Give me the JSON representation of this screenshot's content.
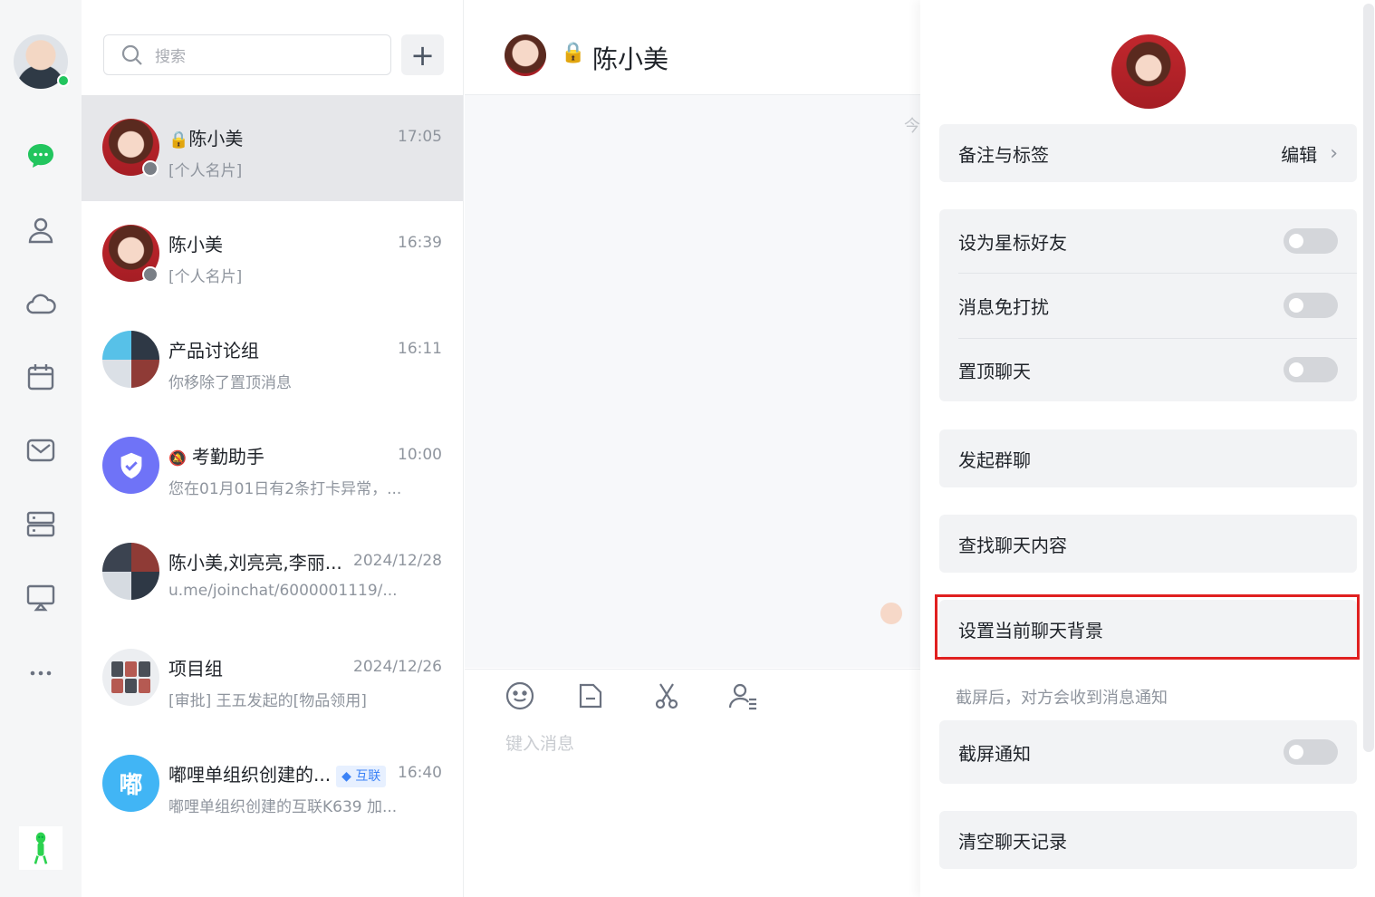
{
  "search": {
    "placeholder": "搜索"
  },
  "chats": [
    {
      "name": "陈小美",
      "time": "17:05",
      "preview": "[个人名片]",
      "locked": true
    },
    {
      "name": "陈小美",
      "time": "16:39",
      "preview": "[个人名片]"
    },
    {
      "name": "产品讨论组",
      "time": "16:11",
      "preview": "你移除了置顶消息"
    },
    {
      "name": "考勤助手",
      "time": "10:00",
      "preview": "您在01月01日有2条打卡异常，..."
    },
    {
      "name": "陈小美,刘亮亮,李丽...",
      "time": "2024/12/28",
      "preview": "u.me/joinchat/6000001119/..."
    },
    {
      "name": "项目组",
      "time": "2024/12/26",
      "preview": "[审批] 王五发起的[物品领用]"
    },
    {
      "name": "嘟哩单组织创建的...",
      "time": "16:40",
      "preview": "嘟哩单组织创建的互联K639 加...",
      "tag": "互联",
      "avatar_text": "嘟"
    }
  ],
  "chat": {
    "title": "陈小美",
    "today_marker": "今",
    "input_placeholder": "键入消息"
  },
  "settings": {
    "remark_label": "备注与标签",
    "edit_label": "编辑",
    "star_friend": "设为星标好友",
    "mute": "消息免打扰",
    "pin": "置顶聊天",
    "start_group": "发起群聊",
    "search_history": "查找聊天内容",
    "set_background": "设置当前聊天背景",
    "screenshot_hint": "截屏后，对方会收到消息通知",
    "screenshot_notify": "截屏通知",
    "clear_history": "清空聊天记录"
  },
  "colors": {
    "accent_green": "#22c55e",
    "highlight_red": "#e02020",
    "link_blue": "#3b82f6"
  }
}
